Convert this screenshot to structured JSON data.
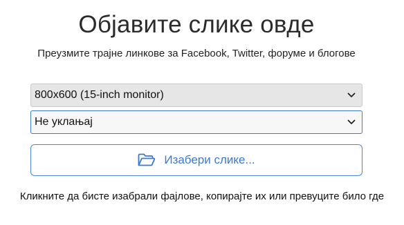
{
  "header": {
    "title": "Објавите слике овде",
    "subtitle": "Преузмите трајне линкове за Facebook, Twitter, форуме и блогове"
  },
  "form": {
    "resolution_select": {
      "selected": "800x600 (15-inch monitor)"
    },
    "remove_select": {
      "selected": "Не уклањај"
    },
    "upload_button": {
      "label": "Изабери слике...",
      "icon": "folder-open-icon"
    }
  },
  "hint": {
    "text": "Кликните да бисте изабрали фајлове, копирајте их или превуците било где"
  },
  "colors": {
    "accent": "#3a78d4",
    "focused_border": "#3d7bd4",
    "select_bg": "#e6e6e6"
  }
}
